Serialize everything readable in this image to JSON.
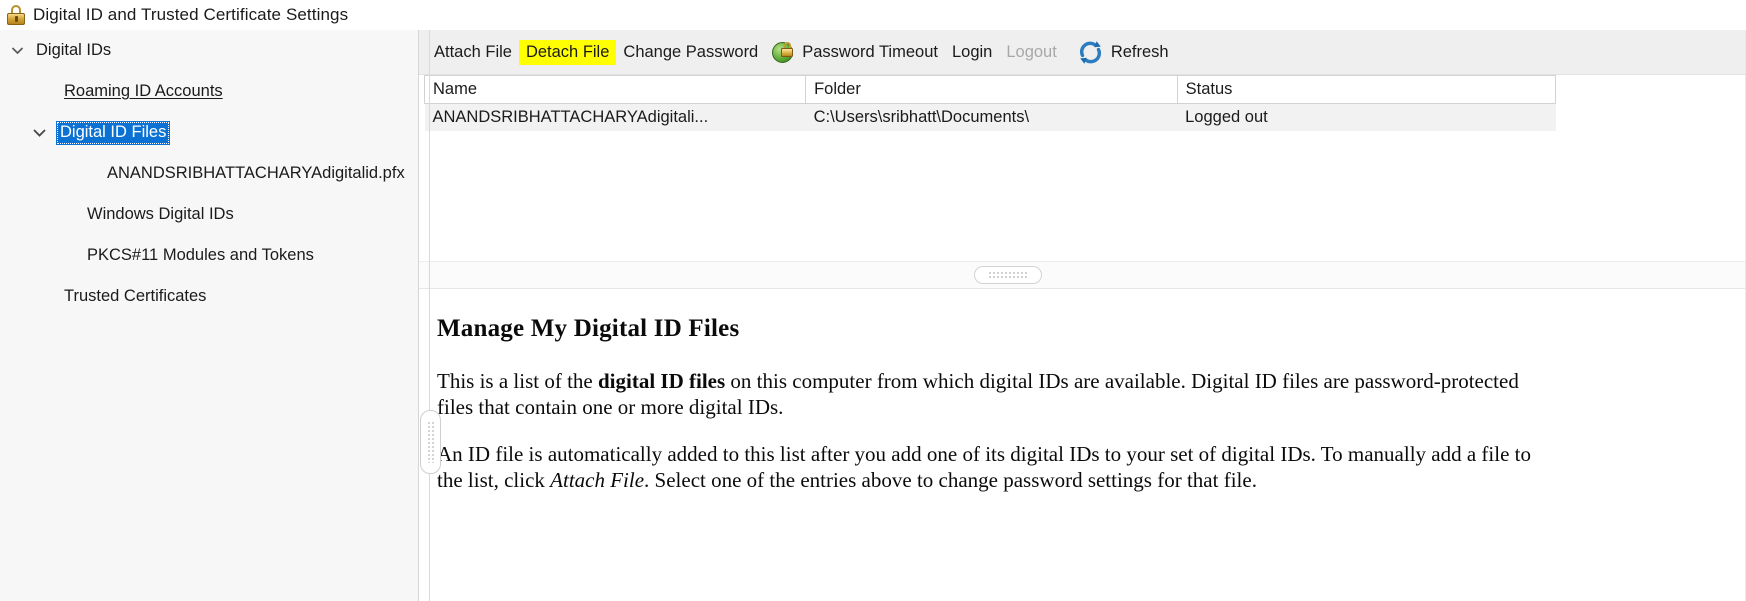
{
  "window": {
    "title": "Digital ID and Trusted Certificate Settings",
    "lock_icon": "padlock-icon"
  },
  "sidebar": {
    "items": [
      {
        "label": "Digital IDs",
        "indent": 0,
        "twisty": "chevron-down-icon",
        "state": "normal"
      },
      {
        "label": "Roaming ID Accounts",
        "indent": 1,
        "twisty": "none",
        "state": "link"
      },
      {
        "label": "Digital ID Files",
        "indent": 1,
        "twisty": "chevron-down-icon",
        "state": "selected"
      },
      {
        "label": "ANANDSRIBHATTACHARYAdigitalid.pfx",
        "indent": 2,
        "twisty": "none",
        "state": "normal"
      },
      {
        "label": "Windows Digital IDs",
        "indent": 1,
        "twisty": "none",
        "state": "normal"
      },
      {
        "label": "PKCS#11 Modules and Tokens",
        "indent": 1,
        "twisty": "none",
        "state": "normal"
      },
      {
        "label": "Trusted Certificates",
        "indent": 0,
        "twisty": "none",
        "state": "normal"
      }
    ],
    "selection_color": "#0b72d4"
  },
  "toolbar": {
    "attach_file": "Attach File",
    "detach_file": "Detach File",
    "detach_file_highlight_color": "#ffff00",
    "change_password": "Change Password",
    "password_timeout": "Password Timeout",
    "password_timeout_icon": "green-lock-clock-icon",
    "login": "Login",
    "logout": "Logout",
    "logout_disabled": true,
    "refresh": "Refresh",
    "refresh_icon": "refresh-circular-arrows-icon",
    "refresh_icon_color": "#1f6bb0"
  },
  "table": {
    "columns": [
      "Name",
      "Folder",
      "Status"
    ],
    "rows": [
      {
        "name": "ANANDSRIBHATTACHARYAdigitali...",
        "folder": "C:\\Users\\sribhatt\\Documents\\",
        "status": "Logged out"
      }
    ]
  },
  "splitter": {
    "horizontal_grip": "horizontal-splitter-grip",
    "vertical_grip": "vertical-splitter-grip"
  },
  "description": {
    "heading": "Manage My Digital ID Files",
    "paragraph1_part1": "This is a list of the ",
    "paragraph1_bold": "digital ID files",
    "paragraph1_part2": " on this computer from which digital IDs are available. Digital ID files are password-protected files that contain one or more digital IDs.",
    "paragraph2_part1": "An ID file is automatically added to this list after you add one of its digital IDs to your set of digital IDs. To manually add a file to the list, click ",
    "paragraph2_italic": "Attach File",
    "paragraph2_part2": ". Select one of the entries above to change password settings for that file."
  }
}
